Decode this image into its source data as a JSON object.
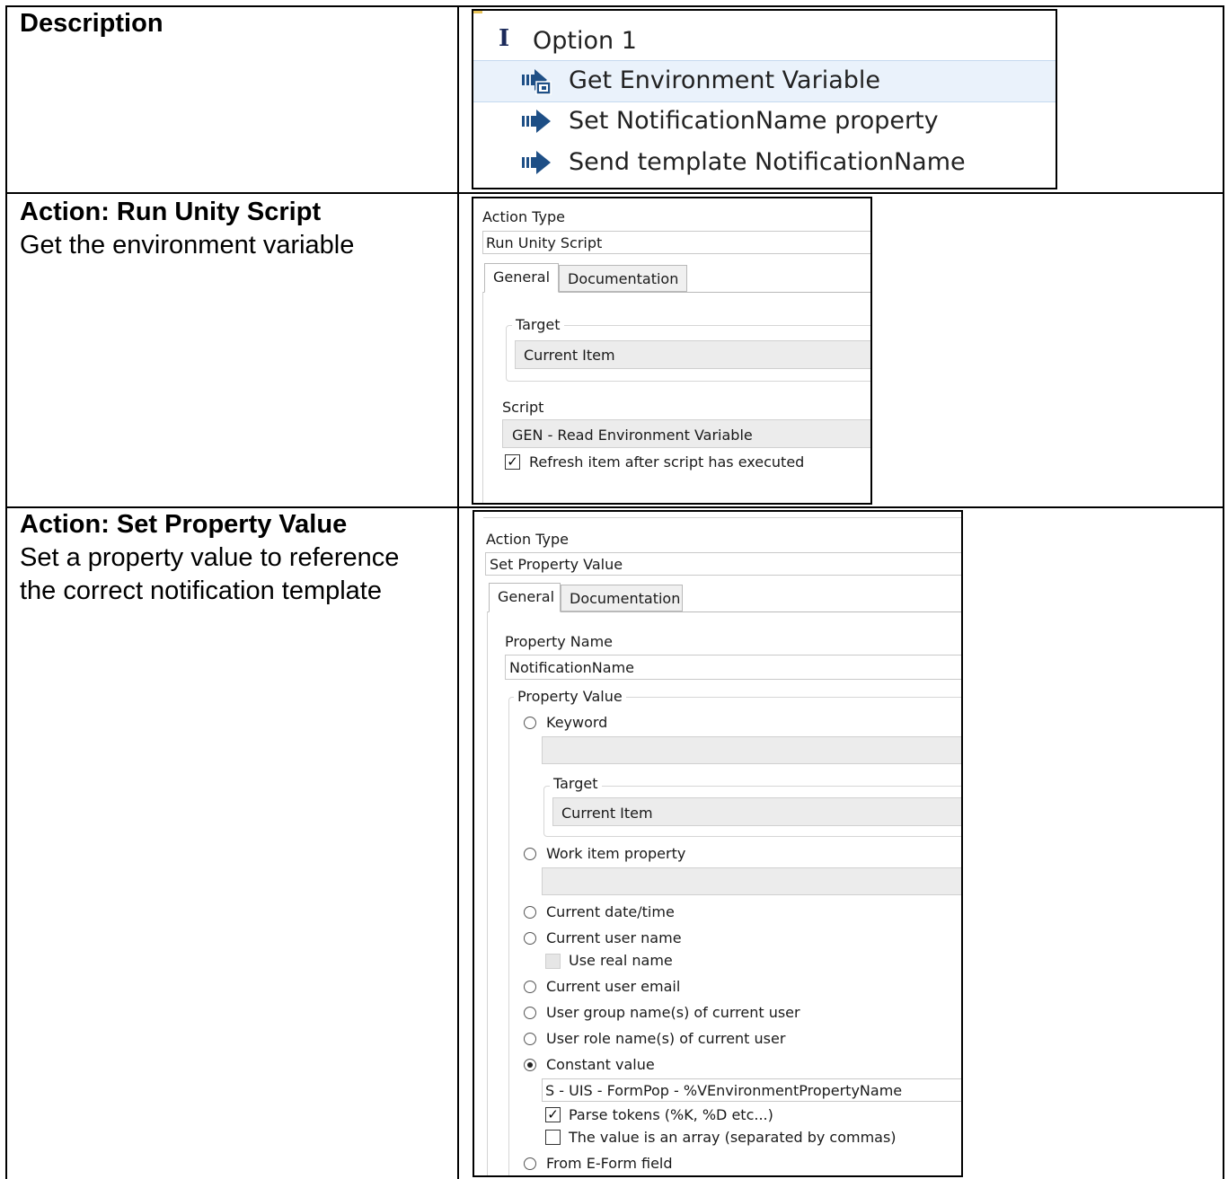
{
  "rows": [
    {
      "heading": "Description",
      "body": ""
    },
    {
      "heading": "Action: Run Unity Script",
      "body": "Get the environment variable"
    },
    {
      "heading": "Action: Set Property Value",
      "body_line1": "Set a property value to reference",
      "body_line2": "the correct notification template"
    }
  ],
  "tree": {
    "root_label": "Option 1",
    "items": [
      {
        "label": "Get Environment Variable",
        "icon": "env-variable-icon",
        "selected": true
      },
      {
        "label": "Set NotificationName property",
        "icon": "arrow-action-icon",
        "selected": false
      },
      {
        "label": "Send template NotificationName",
        "icon": "arrow-action-icon",
        "selected": false
      }
    ]
  },
  "run_script": {
    "action_type_label": "Action Type",
    "action_type_value": "Run Unity Script",
    "tabs": [
      "General",
      "Documentation"
    ],
    "target_legend": "Target",
    "target_value": "Current Item",
    "script_label": "Script",
    "script_value": "GEN - Read Environment Variable",
    "refresh_label": "Refresh item after script has executed",
    "refresh_checked": true
  },
  "set_property": {
    "action_type_label": "Action Type",
    "action_type_value": "Set Property Value",
    "tabs": [
      "General",
      "Documentation"
    ],
    "property_name_label": "Property Name",
    "property_name_value": "NotificationName",
    "property_value_legend": "Property Value",
    "keyword_label": "Keyword",
    "keyword_value": "",
    "target_legend": "Target",
    "target_value": "Current Item",
    "work_item_label": "Work item property",
    "work_item_value": "",
    "current_datetime_label": "Current date/time",
    "current_user_name_label": "Current user name",
    "use_real_name_label": "Use real name",
    "current_user_email_label": "Current user email",
    "user_group_label": "User group name(s) of current user",
    "user_role_label": "User role name(s) of current user",
    "constant_value_label": "Constant value",
    "constant_value": "S - UIS - FormPop - %VEnvironmentPropertyName",
    "parse_tokens_label": "Parse tokens (%K, %D etc...)",
    "parse_tokens_checked": true,
    "array_label": "The value is an array (separated by commas)",
    "array_checked": false,
    "eform_label": "From E-Form field",
    "selected_radio": "Constant value"
  }
}
